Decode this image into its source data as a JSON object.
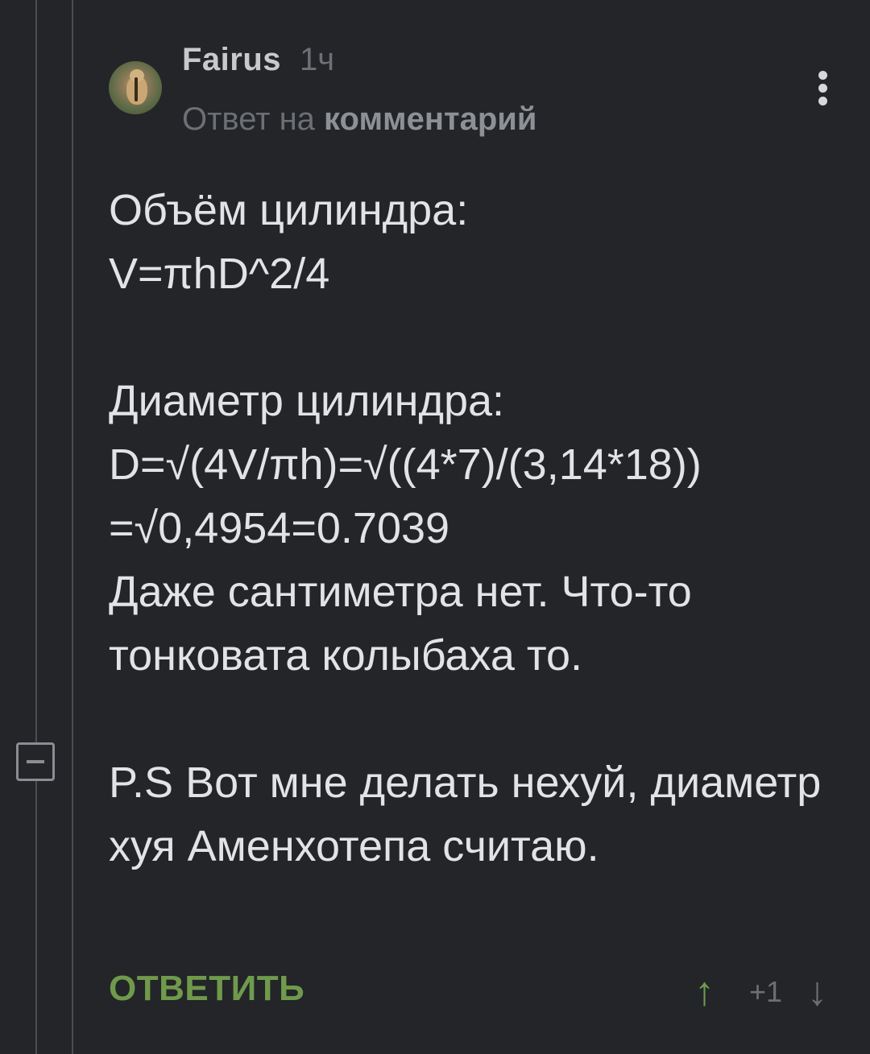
{
  "comment": {
    "author": "Fairus",
    "time": "1ч",
    "reply_prefix": "Ответ на",
    "reply_link": "комментарий",
    "body": "Объём цилиндра:\nV=πhD^2/4\n\nДиаметр цилиндра:\nD=√(4V/πh)=√((4*7)/(3,14*18))\n=√0,4954=0.7039\nДаже сантиметра нет. Что-то тонковата колыбаха то.\n\nP.S Вот мне делать нехуй, диаметр хуя Аменхотепа считаю.",
    "reply_button": "ОТВЕТИТЬ",
    "rating": "+1"
  },
  "icons": {
    "avatar": "chipmunk-avatar",
    "more": "vertical-dots-icon",
    "collapse": "minus-box-icon",
    "upvote": "arrow-up-icon",
    "downvote": "arrow-down-icon"
  },
  "colors": {
    "background": "#232528",
    "text": "#e2e3e5",
    "muted": "#6c6f74",
    "accent_green": "#6f9a4c"
  }
}
